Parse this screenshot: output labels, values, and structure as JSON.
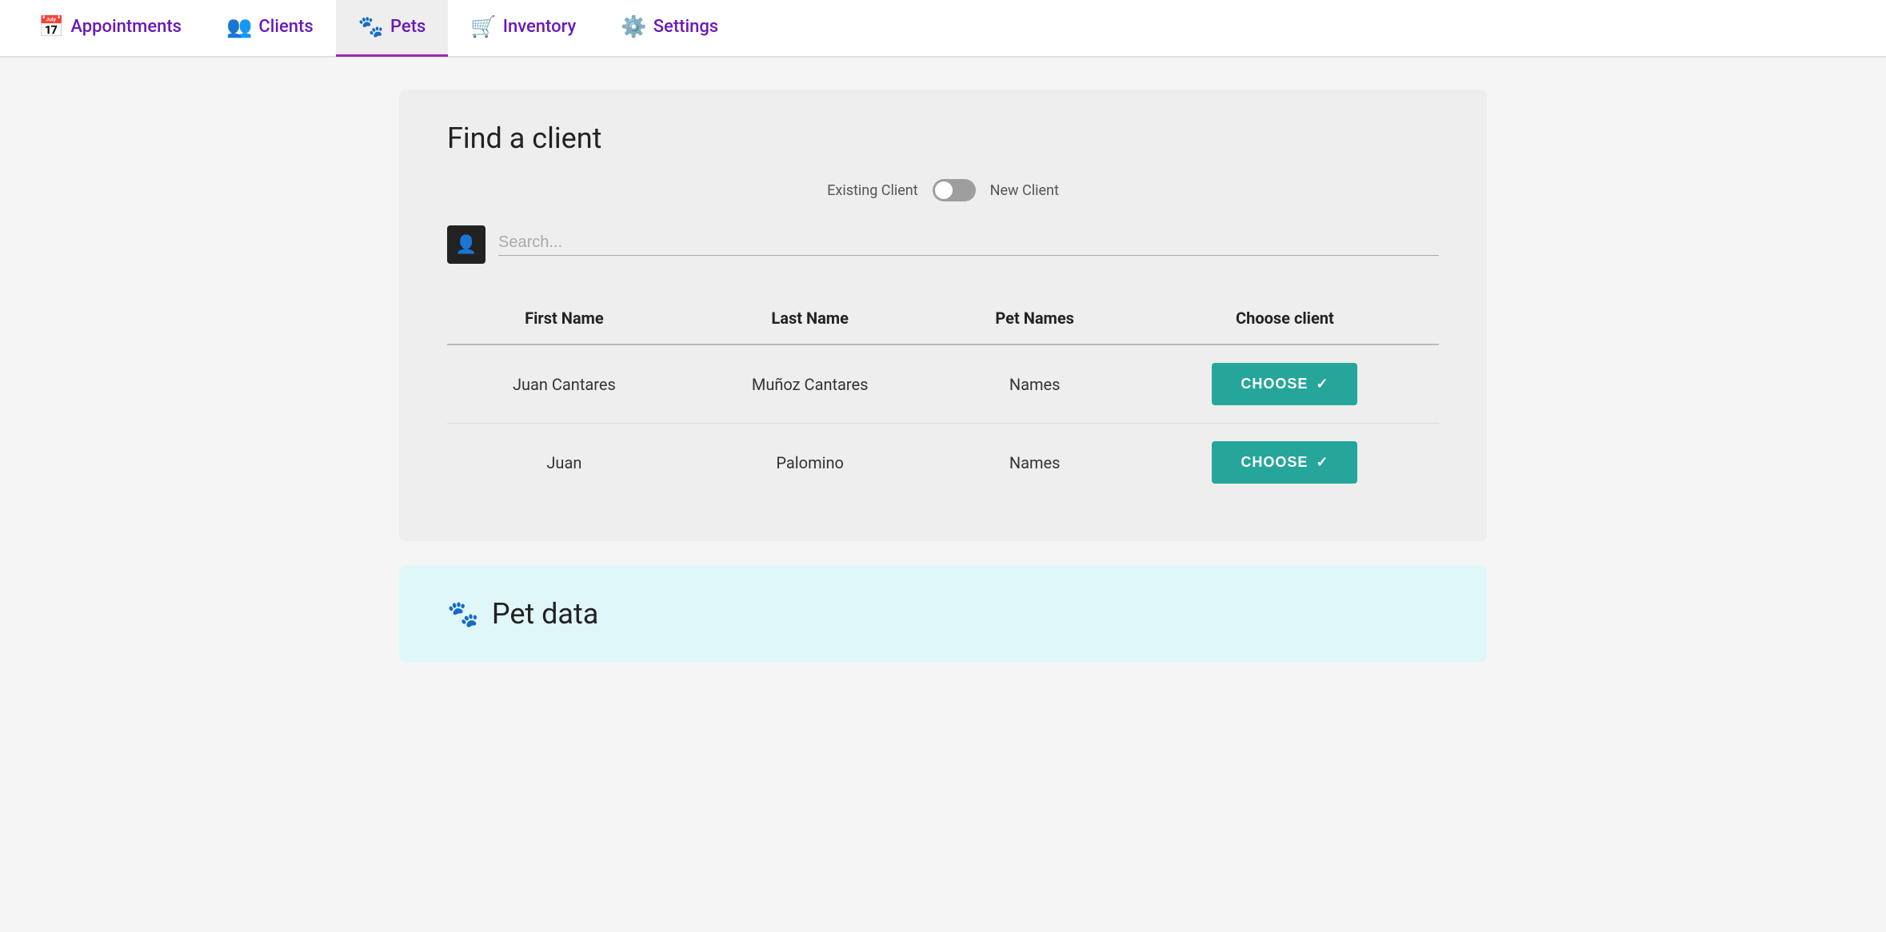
{
  "nav": {
    "items": [
      {
        "id": "appointments",
        "label": "Appointments",
        "icon": "📅",
        "active": false
      },
      {
        "id": "clients",
        "label": "Clients",
        "icon": "👥",
        "active": false
      },
      {
        "id": "pets",
        "label": "Pets",
        "icon": "🐾",
        "active": true
      },
      {
        "id": "inventory",
        "label": "Inventory",
        "icon": "🛒",
        "active": false
      },
      {
        "id": "settings",
        "label": "Settings",
        "icon": "⚙️",
        "active": false
      }
    ]
  },
  "find_client": {
    "title": "Find a client",
    "toggle": {
      "left_label": "Existing Client",
      "right_label": "New Client"
    },
    "search_placeholder": "Search...",
    "table": {
      "columns": [
        "First Name",
        "Last Name",
        "Pet Names",
        "Choose client"
      ],
      "rows": [
        {
          "first_name": "Juan Cantares",
          "last_name": "Muñoz Cantares",
          "pet_names": "Names",
          "btn_label": "CHOOSE"
        },
        {
          "first_name": "Juan",
          "last_name": "Palomino",
          "pet_names": "Names",
          "btn_label": "CHOOSE"
        }
      ]
    }
  },
  "pet_data": {
    "title": "Pet data",
    "icon": "🐾"
  }
}
